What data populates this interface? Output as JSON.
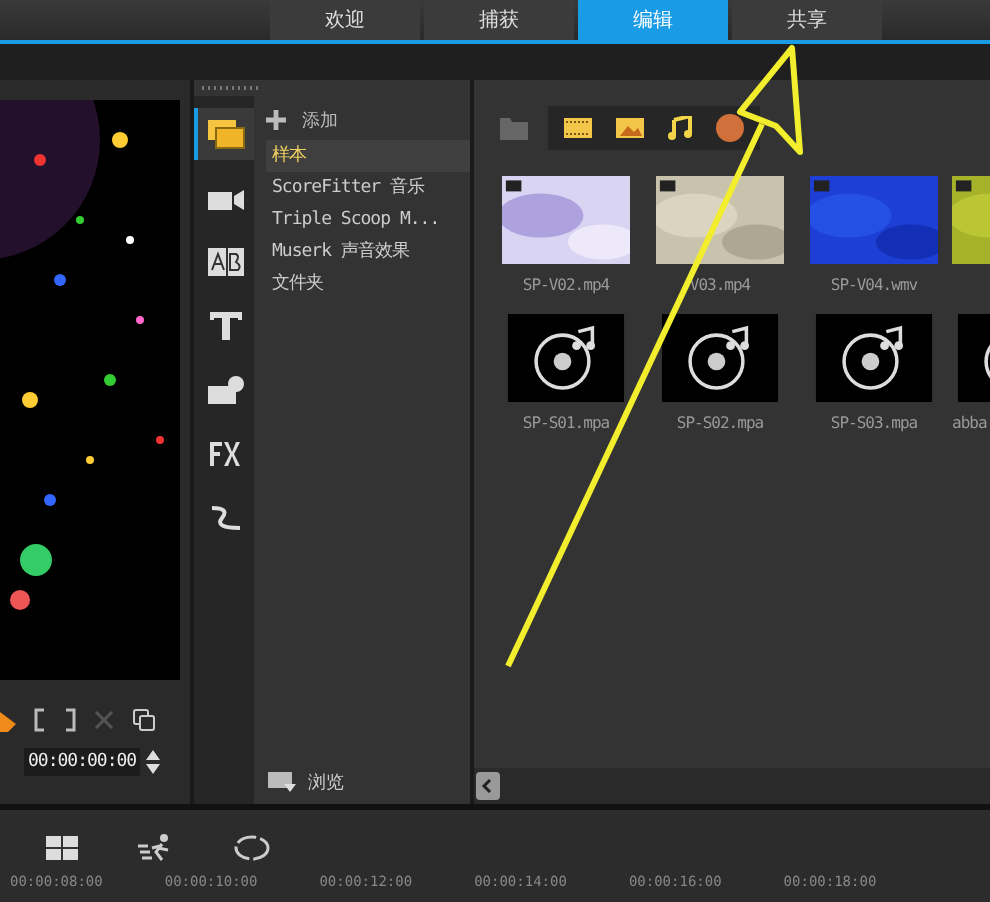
{
  "tabs": [
    {
      "label": "欢迎",
      "selected": false
    },
    {
      "label": "捕获",
      "selected": false
    },
    {
      "label": "编辑",
      "selected": true
    },
    {
      "label": "共享",
      "selected": false
    }
  ],
  "preview": {
    "timecode": "00:00:00:00"
  },
  "library_icons": [
    {
      "kind": "media",
      "selected": true
    },
    {
      "kind": "template",
      "selected": false
    },
    {
      "kind": "transition",
      "selected": false
    },
    {
      "kind": "title",
      "selected": false
    },
    {
      "kind": "graphic",
      "selected": false
    },
    {
      "kind": "filter",
      "selected": false
    },
    {
      "kind": "path",
      "selected": false
    }
  ],
  "library": {
    "add": "添加",
    "items": [
      {
        "label": "样本",
        "selected": true
      },
      {
        "label": "ScoreFitter 音乐",
        "selected": false
      },
      {
        "label": "Triple Scoop M...",
        "selected": false
      },
      {
        "label": "Muserk 声音效果",
        "selected": false
      },
      {
        "label": "文件夹",
        "selected": false
      }
    ],
    "browse": "浏览"
  },
  "media": [
    {
      "kind": "video",
      "name": "SP-V02.mp4"
    },
    {
      "kind": "video",
      "name": "V03.mp4"
    },
    {
      "kind": "video",
      "name": "SP-V04.wmv"
    },
    {
      "kind": "video"
    },
    {
      "kind": "audio",
      "name": "SP-S01.mpa"
    },
    {
      "kind": "audio",
      "name": "SP-S02.mpa"
    },
    {
      "kind": "audio",
      "name": "SP-S03.mpa"
    },
    {
      "kind": "audio",
      "name": "abba"
    }
  ],
  "timeline": {
    "ticks": [
      "00:00:08:00",
      "00:00:10:00",
      "00:00:12:00",
      "00:00:14:00",
      "00:00:16:00",
      "00:00:18:00"
    ]
  }
}
